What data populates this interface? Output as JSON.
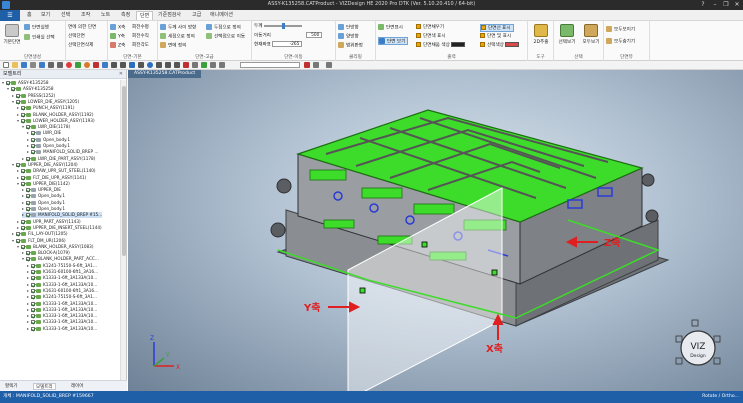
{
  "window": {
    "title": "ASSY-K135258.CATProduct - VIZDesign HE 2020 Pro DTK (Ver. 5.10.20.410 / 64-bit)",
    "controls": [
      "?",
      "–",
      "❐",
      "✕"
    ]
  },
  "menubar": {
    "file": "☰",
    "items": [
      {
        "label": "홈",
        "active": false
      },
      {
        "label": "보기",
        "active": false
      },
      {
        "label": "선택",
        "active": false
      },
      {
        "label": "조작",
        "active": false
      },
      {
        "label": "노트",
        "active": false
      },
      {
        "label": "측정",
        "active": false
      },
      {
        "label": "단면",
        "active": true
      },
      {
        "label": "기준점검사",
        "active": false
      },
      {
        "label": "고급",
        "active": false
      },
      {
        "label": "애니메이션",
        "active": false
      }
    ]
  },
  "ribbon": {
    "group_basic": {
      "label": "단면생성",
      "big_button": "기본단면",
      "items": [
        "단면실행",
        "인쇄실 선택"
      ]
    },
    "group_create": {
      "items": [
        "면에 의한 단면",
        "선택단면",
        "선택단면삭제"
      ]
    },
    "group_plane": {
      "label": "단면-기본",
      "items": [
        {
          "prefix": "X축",
          "label": "회전수평"
        },
        {
          "prefix": "Y축",
          "label": "회전수직"
        },
        {
          "prefix": "Z축",
          "label": "회전각도"
        }
      ]
    },
    "group_advanced": {
      "label": "단면-고급",
      "items": [
        "두께 사이 방향",
        "세점으로 정의",
        "면에 정의",
        "두점으로 정의",
        "선택점으로 이동"
      ]
    },
    "group_move": {
      "label": "단면-이동",
      "thickness_label": "두께",
      "thickness_value": "500",
      "move_label": "이동거리",
      "move_value": "1",
      "current_label": "현재좌표",
      "current_value": "-265"
    },
    "group_clip": {
      "label": "클리핑",
      "items": [
        "단방향",
        "양방향",
        "범위판정"
      ]
    },
    "group_output": {
      "label": "출력",
      "items": [
        "단면표시",
        "단면 보기",
        "단면채우기",
        "단면색 표시",
        "단면채움 색상",
        "단면선 표시",
        "단면 및 표시",
        "선택색상"
      ],
      "fill_color": "#222222",
      "select_color": "#d94a4a"
    },
    "group_tool": {
      "label": "도구",
      "big_button": "2D추출"
    },
    "group_select": {
      "label": "선택",
      "big_buttons": [
        "선택보기",
        "모두보기"
      ]
    },
    "group_view": {
      "label": "단면뷰",
      "items": [
        "모두보이기",
        "모두숨기기"
      ]
    }
  },
  "tree": {
    "title": "모델트리",
    "rows": [
      {
        "indent": 0,
        "label": "ASSY-K135258",
        "icon": "assy",
        "open": true
      },
      {
        "indent": 1,
        "label": "ASSY-K135258",
        "icon": "assy",
        "open": true
      },
      {
        "indent": 2,
        "label": "PRESS(1252)",
        "icon": "assy",
        "open": false
      },
      {
        "indent": 2,
        "label": "LOWER_DIE_ASSY(1205)",
        "icon": "assy",
        "open": true
      },
      {
        "indent": 3,
        "label": "PUNCH_ASSY(1191)",
        "icon": "assy",
        "open": false
      },
      {
        "indent": 3,
        "label": "BLANK_HOLDER_ASSY(1192)",
        "icon": "assy",
        "open": false
      },
      {
        "indent": 3,
        "label": "LOWER_HOLDER_ASSY(1193)",
        "icon": "assy",
        "open": true
      },
      {
        "indent": 4,
        "label": "LWR_DIE(1178)",
        "icon": "assy",
        "open": true
      },
      {
        "indent": 5,
        "label": "LWR_DIE",
        "icon": "body",
        "open": false
      },
      {
        "indent": 5,
        "label": "Open_body.1",
        "icon": "body",
        "open": false
      },
      {
        "indent": 5,
        "label": "Open_body.1",
        "icon": "body",
        "open": false
      },
      {
        "indent": 5,
        "label": "MANIFOLD_SOLID_BREP ...",
        "icon": "body",
        "open": false
      },
      {
        "indent": 4,
        "label": "LWR_DIE_PART_ASSY(1178)",
        "icon": "assy",
        "open": false
      },
      {
        "indent": 2,
        "label": "UPPER_DIE_ASSY(1204)",
        "icon": "assy",
        "open": true
      },
      {
        "indent": 3,
        "label": "DRAW_UPR_SUT_STEEL(1140)",
        "icon": "assy",
        "open": false
      },
      {
        "indent": 3,
        "label": "FLT_DIE_UPR_ASSY(1141)",
        "icon": "assy",
        "open": false
      },
      {
        "indent": 3,
        "label": "UPPER_DIE(1142)",
        "icon": "assy",
        "open": true
      },
      {
        "indent": 4,
        "label": "UPPER_DIE",
        "icon": "body",
        "open": false
      },
      {
        "indent": 4,
        "label": "Open_body.1",
        "icon": "body",
        "open": false
      },
      {
        "indent": 4,
        "label": "Open_body.1",
        "icon": "body",
        "open": false
      },
      {
        "indent": 4,
        "label": "Open_body.1",
        "icon": "body",
        "open": false
      },
      {
        "indent": 4,
        "label": "MANIFOLD_SOLID_BREP #15...",
        "icon": "body",
        "open": false,
        "highlight": true
      },
      {
        "indent": 3,
        "label": "UPR_PART_ASSY(1143)",
        "icon": "assy",
        "open": false
      },
      {
        "indent": 3,
        "label": "UPPER_DIE_INSERT_STEEL(1144)",
        "icon": "assy",
        "open": false
      },
      {
        "indent": 2,
        "label": "FIL_LAY-OUT(1205)",
        "icon": "assy",
        "open": false
      },
      {
        "indent": 2,
        "label": "FLT_DM_UR(1206)",
        "icon": "assy",
        "open": true
      },
      {
        "indent": 3,
        "label": "BLANK_HOLDER_ASSY(1083)",
        "icon": "assy",
        "open": true
      },
      {
        "indent": 4,
        "label": "BLOCK-A(1079)",
        "icon": "assy",
        "open": false
      },
      {
        "indent": 4,
        "label": "BLANK_HOLDER_PART_ACC...",
        "icon": "assy",
        "open": true
      },
      {
        "indent": 5,
        "label": "K1241-75150-S-6ft_3A1...",
        "icon": "assy",
        "open": false
      },
      {
        "indent": 5,
        "label": "K1631-60100-6ft1_3A16...",
        "icon": "assy",
        "open": false
      },
      {
        "indent": 5,
        "label": "K1333-1-6ft_3A133A(10...",
        "icon": "assy",
        "open": false
      },
      {
        "indent": 5,
        "label": "K1333-1-6ft_3A133A(10...",
        "icon": "assy",
        "open": false
      },
      {
        "indent": 5,
        "label": "K1631-60100-6ft1_3A16...",
        "icon": "assy",
        "open": false
      },
      {
        "indent": 5,
        "label": "K1241-75150-S-6ft_3A1...",
        "icon": "assy",
        "open": false
      },
      {
        "indent": 5,
        "label": "K1333-1-6ft_3A133A(10...",
        "icon": "assy",
        "open": false
      },
      {
        "indent": 5,
        "label": "K1333-1-6ft_3A133A(10...",
        "icon": "assy",
        "open": false
      },
      {
        "indent": 5,
        "label": "K1333-1-6ft_3A133A(10...",
        "icon": "assy",
        "open": false
      },
      {
        "indent": 5,
        "label": "K1333-1-6ft_3A133A(10...",
        "icon": "assy",
        "open": false
      },
      {
        "indent": 5,
        "label": "K1333-1-6ft_3A133A(10...",
        "icon": "assy",
        "open": false
      }
    ],
    "tabs": [
      "할렉기",
      "모델트리",
      "레이어"
    ]
  },
  "viewport": {
    "tab": "ASSY-K135258.CATProduct",
    "axis_labels": {
      "x": "X축",
      "y": "Y축",
      "z": "Z축"
    },
    "triad": {
      "x": "X",
      "y": "Y",
      "z": "Z"
    },
    "brand": "VIZ",
    "brand_sub": "Design",
    "colors": {
      "section_green": "#3ddc2a",
      "part_grey": "#8a8c8e",
      "plane_white": "#ffffff",
      "arrow_red": "#e02020",
      "blue_parts": "#2a3bd6"
    }
  },
  "statusbar": {
    "left": "개체 : MANIFOLD_SOLID_BREP #159667",
    "right": "Rotate / Ortho..."
  }
}
